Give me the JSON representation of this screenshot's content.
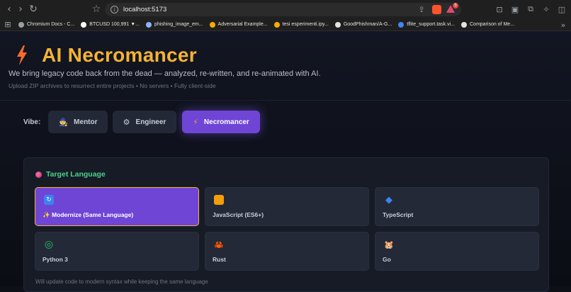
{
  "browser": {
    "url": "localhost:5173",
    "bookmarks": [
      {
        "label": "Chromium Docs - C...",
        "color": "#9aa0a6"
      },
      {
        "label": "BTCUSD 100,991 ▼...",
        "color": "#ffffff"
      },
      {
        "label": "phishing_image_em...",
        "color": "#8ab4f8"
      },
      {
        "label": "Adversarial Example...",
        "color": "#f9ab00"
      },
      {
        "label": "tesi esperimenti.ipy...",
        "color": "#f9ab00"
      },
      {
        "label": "GoodPhishman/A-G...",
        "color": "#e3e3e3"
      },
      {
        "label": "tflite_support.task.vi...",
        "color": "#4285f4"
      },
      {
        "label": "Comparison of Me...",
        "color": "#e3e3e3"
      }
    ],
    "badge_count": "5"
  },
  "header": {
    "title": "AI Necromancer",
    "subtitle": "We bring legacy code back from the dead — analyzed, re-written, and re-animated with AI.",
    "hint": "Upload ZIP archives to resurrect entire projects • No servers • Fully client-side"
  },
  "vibe": {
    "label": "Vibe:",
    "options": [
      {
        "label": "Mentor",
        "icon": "🧙"
      },
      {
        "label": "Engineer",
        "icon": "⚙"
      },
      {
        "label": "Necromancer",
        "icon": "⚡",
        "active": true
      }
    ]
  },
  "target": {
    "title": "Target Language",
    "languages": [
      {
        "label": "✨ Modernize (Same Language)",
        "icon": "↻",
        "icon_color": "#3b82f6",
        "active": true
      },
      {
        "label": "JavaScript (ES6+)",
        "icon": "",
        "icon_color": "#f59e0b"
      },
      {
        "label": "TypeScript",
        "icon": "◆",
        "icon_color": "#3b82f6"
      },
      {
        "label": "Python 3",
        "icon": "◎",
        "icon_color": "#22c55e"
      },
      {
        "label": "Rust",
        "icon": "🦀",
        "icon_color": "#ef4444"
      },
      {
        "label": "Go",
        "icon": "🐹",
        "icon_color": "#f9a8d4"
      }
    ],
    "note": "Will update code to modern syntax while keeping the same language"
  }
}
